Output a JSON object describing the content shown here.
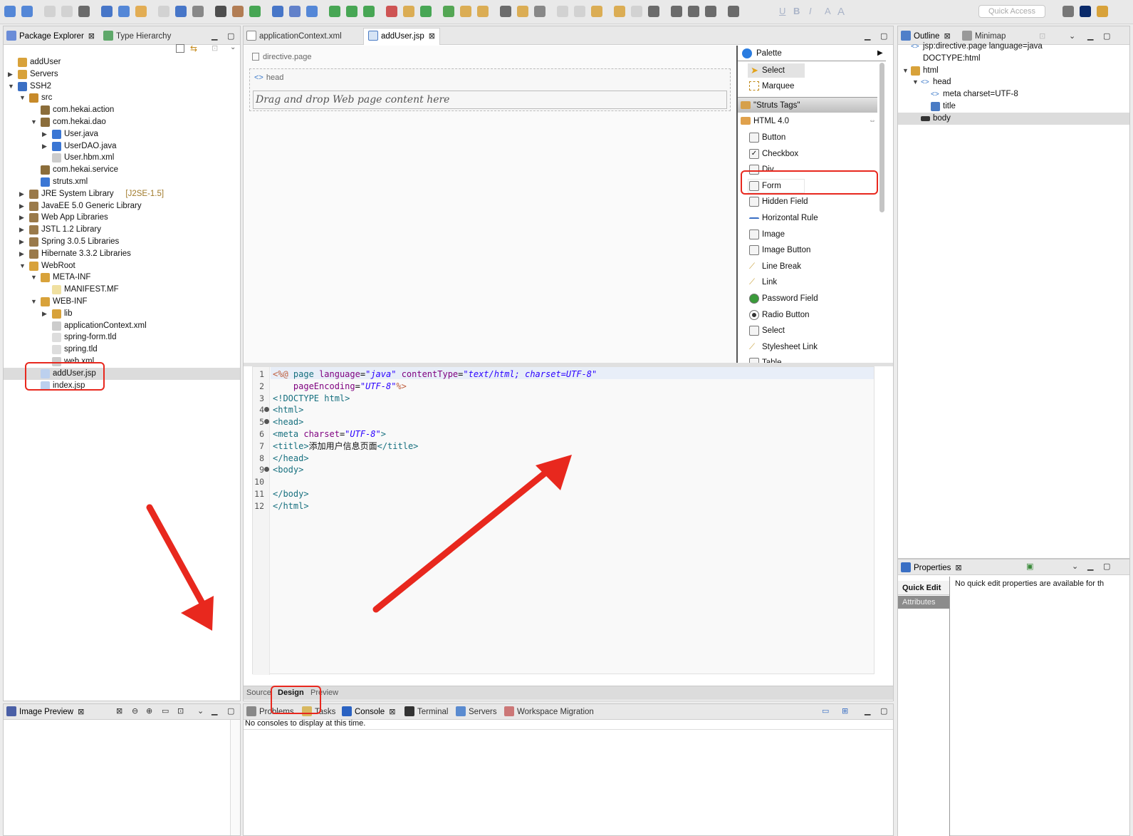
{
  "toolbar": {
    "quick_access_placeholder": "Quick Access",
    "format_buttons": [
      "U",
      "B",
      "I",
      "A",
      "A"
    ]
  },
  "package_explorer": {
    "tabs": [
      "Package Explorer",
      "Type Hierarchy"
    ],
    "tree": [
      {
        "label": "addUser",
        "icon": "project-folder-icon",
        "twisty": ""
      },
      {
        "label": "Servers",
        "icon": "folder-icon",
        "twisty": "▶"
      },
      {
        "label": "SSH2",
        "icon": "project-icon",
        "twisty": "▼"
      },
      {
        "label": "src",
        "icon": "source-folder-icon",
        "twisty": "▼"
      },
      {
        "label": "com.hekai.action",
        "icon": "package-icon",
        "twisty": ""
      },
      {
        "label": "com.hekai.dao",
        "icon": "package-icon",
        "twisty": "▼"
      },
      {
        "label": "User.java",
        "icon": "java-file-icon",
        "twisty": "▶"
      },
      {
        "label": "UserDAO.java",
        "icon": "java-file-icon",
        "twisty": "▶"
      },
      {
        "label": "User.hbm.xml",
        "icon": "xml-file-icon",
        "twisty": ""
      },
      {
        "label": "com.hekai.service",
        "icon": "package-icon",
        "twisty": ""
      },
      {
        "label": "struts.xml",
        "icon": "gear-file-icon",
        "twisty": ""
      },
      {
        "label": "JRE System Library",
        "decoration": "[J2SE-1.5]",
        "icon": "library-icon",
        "twisty": "▶"
      },
      {
        "label": "JavaEE 5.0 Generic Library",
        "icon": "library-icon",
        "twisty": "▶"
      },
      {
        "label": "Web App Libraries",
        "icon": "library-icon",
        "twisty": "▶"
      },
      {
        "label": "JSTL 1.2 Library",
        "icon": "library-icon",
        "twisty": "▶"
      },
      {
        "label": "Spring 3.0.5 Libraries",
        "icon": "library-icon",
        "twisty": "▶"
      },
      {
        "label": "Hibernate 3.3.2 Libraries",
        "icon": "library-icon",
        "twisty": "▶"
      },
      {
        "label": "WebRoot",
        "icon": "folder-icon",
        "twisty": "▼"
      },
      {
        "label": "META-INF",
        "icon": "folder-icon",
        "twisty": "▼"
      },
      {
        "label": "MANIFEST.MF",
        "icon": "text-file-icon",
        "twisty": ""
      },
      {
        "label": "WEB-INF",
        "icon": "folder-icon",
        "twisty": "▼"
      },
      {
        "label": "lib",
        "icon": "folder-icon",
        "twisty": "▶"
      },
      {
        "label": "applicationContext.xml",
        "icon": "xml-file-icon",
        "twisty": ""
      },
      {
        "label": "spring-form.tld",
        "icon": "tld-file-icon",
        "twisty": ""
      },
      {
        "label": "spring.tld",
        "icon": "tld-file-icon",
        "twisty": ""
      },
      {
        "label": "web.xml",
        "icon": "xml-file-icon",
        "twisty": ""
      },
      {
        "label": "addUser.jsp",
        "icon": "jsp-file-icon",
        "twisty": ""
      },
      {
        "label": "index.jsp",
        "icon": "jsp-file-icon",
        "twisty": ""
      }
    ]
  },
  "editor": {
    "tabs": [
      "applicationContext.xml",
      "addUser.jsp"
    ],
    "design": {
      "directive_label": "directive.page",
      "head_label": "head",
      "drop_hint": "Drag and drop Web page content here"
    },
    "bottom_tabs": [
      "Source",
      "Design",
      "Preview"
    ],
    "code_lines": [
      {
        "n": "1",
        "html": "<span class='jsp'>&lt;%@</span> <span class='tag'>page</span> <span class='attr'>language</span>=<span class='val'>\"java\"</span> <span class='attr'>contentType</span>=<span class='val'>\"text/html; charset=UTF-8\"</span>"
      },
      {
        "n": "2",
        "html": "    <span class='attr'>pageEncoding</span>=<span class='val'>\"UTF-8\"</span><span class='jsp'>%&gt;</span>"
      },
      {
        "n": "3",
        "html": "<span class='tag'>&lt;!DOCTYPE html&gt;</span>"
      },
      {
        "n": "4",
        "html": "<span class='tag'>&lt;html&gt;</span>"
      },
      {
        "n": "5",
        "html": "<span class='tag'>&lt;head&gt;</span>"
      },
      {
        "n": "6",
        "html": "<span class='tag'>&lt;meta</span> <span class='attr'>charset</span>=<span class='val'>\"UTF-8\"</span><span class='tag'>&gt;</span>"
      },
      {
        "n": "7",
        "html": "<span class='tag'>&lt;title&gt;</span>添加用户信息页面<span class='tag'>&lt;/title&gt;</span>"
      },
      {
        "n": "8",
        "html": "<span class='tag'>&lt;/head&gt;</span>"
      },
      {
        "n": "9",
        "html": "<span class='tag'>&lt;body&gt;</span>"
      },
      {
        "n": "10",
        "html": ""
      },
      {
        "n": "11",
        "html": "<span class='tag'>&lt;/body&gt;</span>"
      },
      {
        "n": "12",
        "html": "<span class='tag'>&lt;/html&gt;</span>"
      }
    ]
  },
  "palette": {
    "title": "Palette",
    "tools": [
      "Select",
      "Marquee"
    ],
    "drawer_struts": "\"Struts Tags\"",
    "drawer_html": "HTML 4.0",
    "items": [
      "Button",
      "Checkbox",
      "Div",
      "Form",
      "Hidden Field",
      "Horizontal Rule",
      "Image",
      "Image Button",
      "Line Break",
      "Link",
      "Password Field",
      "Radio Button",
      "Select",
      "Stylesheet Link",
      "Table"
    ]
  },
  "outline": {
    "tabs": [
      "Outline",
      "Minimap"
    ],
    "tree": [
      {
        "label": "jsp:directive.page language=java",
        "indent": 0,
        "twisty": ""
      },
      {
        "label": "DOCTYPE:html",
        "indent": 0,
        "twisty": ""
      },
      {
        "label": "html",
        "indent": 0,
        "twisty": "▼"
      },
      {
        "label": "head",
        "indent": 1,
        "twisty": "▼"
      },
      {
        "label": "meta charset=UTF-8",
        "indent": 2,
        "twisty": ""
      },
      {
        "label": "title",
        "indent": 2,
        "twisty": ""
      },
      {
        "label": "body",
        "indent": 1,
        "twisty": ""
      }
    ]
  },
  "properties": {
    "tab": "Properties",
    "side_tabs": [
      "Quick Edit",
      "Attributes"
    ],
    "message": "No quick edit properties are available for th"
  },
  "image_preview": {
    "tab": "Image Preview"
  },
  "console": {
    "tabs": [
      "Problems",
      "Tasks",
      "Console",
      "Terminal",
      "Servers",
      "Workspace Migration"
    ],
    "message": "No consoles to display at this time."
  },
  "annotation_color": "#e8281e"
}
